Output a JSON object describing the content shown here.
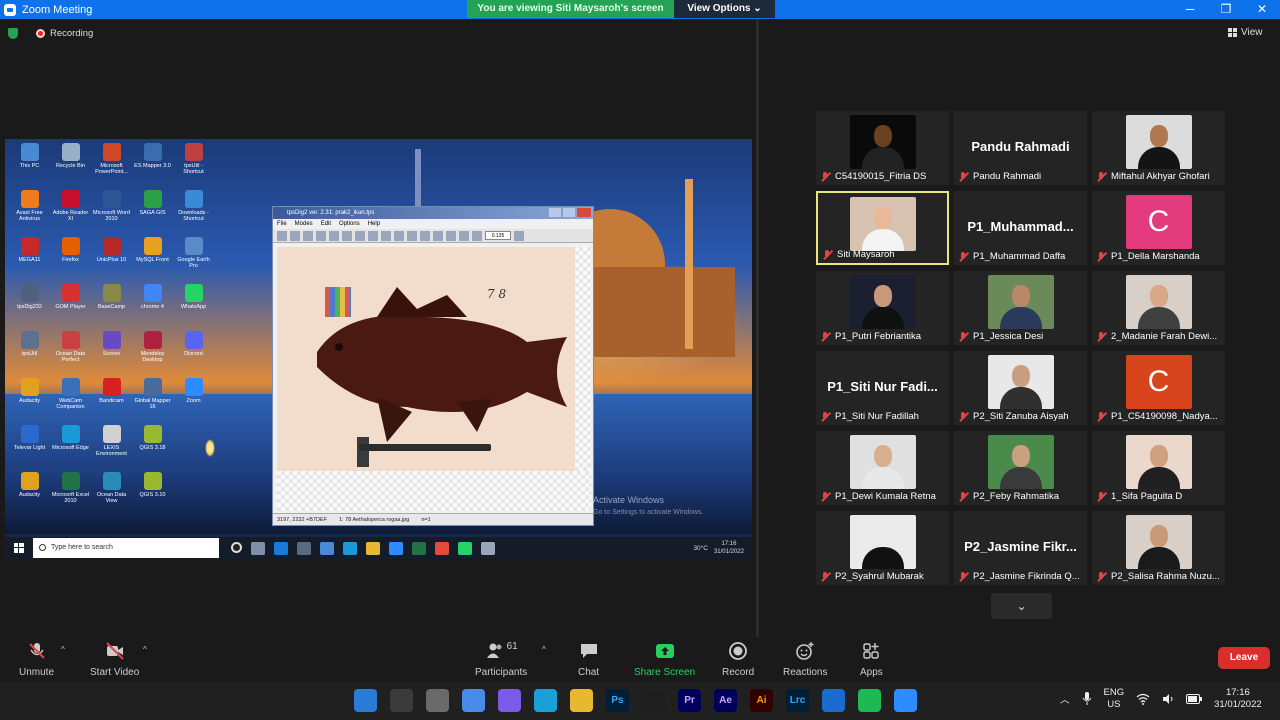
{
  "window": {
    "title": "Zoom Meeting",
    "banner": "You are viewing Siti Maysaroh's screen",
    "view_options": "View Options ⌄",
    "controls": [
      "─",
      "❐",
      "✕"
    ]
  },
  "status": {
    "recording": "Recording",
    "view": "View"
  },
  "shared_screen": {
    "desktop_icons": [
      {
        "label": "This PC",
        "color": "#4a8ad0"
      },
      {
        "label": "Recycle Bin",
        "color": "#9ab0c8"
      },
      {
        "label": "Microsoft PowerPoint...",
        "color": "#d24726"
      },
      {
        "label": "ES Mapper 3.0",
        "color": "#3c6cb0"
      },
      {
        "label": "Avast Free Antivirus",
        "color": "#f07a1e"
      },
      {
        "label": "Adobe Reader XI",
        "color": "#c8102e"
      },
      {
        "label": "Microsoft Word 2010",
        "color": "#2b5797"
      },
      {
        "label": "SAGA GIS",
        "color": "#2aa048"
      },
      {
        "label": "MEGA11",
        "color": "#c82828"
      },
      {
        "label": "Firefox",
        "color": "#e66000"
      },
      {
        "label": "UnicPlus 10",
        "color": "#b82828"
      },
      {
        "label": "MySQL Front",
        "color": "#e8a020"
      },
      {
        "label": "tpsDig232",
        "color": "#506080"
      },
      {
        "label": "GOM Player",
        "color": "#d83030"
      },
      {
        "label": "BaseCamp",
        "color": "#888848"
      },
      {
        "label": "chrome 4",
        "color": "#4285f4"
      },
      {
        "label": "tpsUtil",
        "color": "#607090"
      },
      {
        "label": "Ocean Data Perfect",
        "color": "#c84040"
      },
      {
        "label": "Screen",
        "color": "#6a4ac0"
      },
      {
        "label": "Mendeley Desktop",
        "color": "#b02040"
      },
      {
        "label": "Audacity",
        "color": "#e0a020"
      },
      {
        "label": "WebCam Companion",
        "color": "#3a70b8"
      },
      {
        "label": "Bandicam",
        "color": "#d82020"
      },
      {
        "label": "Global Mapper 16",
        "color": "#4a6a9a"
      },
      {
        "label": "Televar Light",
        "color": "#2a6ad0"
      },
      {
        "label": "Microsoft Edge",
        "color": "#1a9ad8"
      },
      {
        "label": "LEXIS Environment",
        "color": "#d0d0d0"
      },
      {
        "label": "QGIS 3.18",
        "color": "#98b830"
      },
      {
        "label": "Audacity",
        "color": "#e0a020"
      },
      {
        "label": "Microsoft Excel 2010",
        "color": "#217346"
      },
      {
        "label": "Ocean Data View",
        "color": "#2a8ab8"
      },
      {
        "label": "QGIS 3.10",
        "color": "#98b830"
      }
    ],
    "desktop_col5": [
      {
        "label": "tpsUtil - Shortcut",
        "color": "#c04040"
      },
      {
        "label": "Downloads - Shortcut",
        "color": "#3a8ad8"
      },
      {
        "label": "Google Earth Pro",
        "color": "#5a8ac8"
      },
      {
        "label": "WhatsApp",
        "color": "#25d366"
      },
      {
        "label": "Discord",
        "color": "#5865f2"
      },
      {
        "label": "Zoom",
        "color": "#2d8cff"
      }
    ],
    "tps": {
      "title": "tpsDig2 ver. 2.31: prak2_ikan.tps",
      "menu": [
        "File",
        "Modes",
        "Edit",
        "Options",
        "Help"
      ],
      "zoom": "0.135",
      "specimen_no": "7 8",
      "status_coords": "3197, 2232 +B7DEF",
      "status_file": "1: 78 Aethaloperca rogaa.jpg",
      "status_n": "n=1"
    },
    "activate_title": "Activate Windows",
    "activate_sub": "Go to Settings to activate Windows.",
    "taskbar": {
      "search": "Type here to search",
      "weather": "30°C",
      "time": "17:16",
      "date": "31/01/2022"
    }
  },
  "participants": [
    {
      "name": "C54190015_Fitria DS",
      "kind": "video",
      "bg": "#0a0a0a",
      "skin": "#6a4020",
      "shirt": "#222"
    },
    {
      "name": "Pandu Rahmadi",
      "kind": "text",
      "big": "Pandu Rahmadi"
    },
    {
      "name": "Miftahul Akhyar Ghofari",
      "kind": "video",
      "bg": "#dcdcdc",
      "skin": "#b07850",
      "shirt": "#141414"
    },
    {
      "name": "Siti Maysaroh",
      "kind": "video",
      "bg": "#d8c2b0",
      "skin": "#e8b898",
      "shirt": "#f4f4f4",
      "active": true
    },
    {
      "name": "P1_Muhammad Daffa",
      "kind": "text",
      "big": "P1_Muhammad..."
    },
    {
      "name": "P1_Della Marshanda",
      "kind": "initial",
      "initial": "C",
      "color": "#e23a7c"
    },
    {
      "name": "P1_Putri Febriantika",
      "kind": "video",
      "bg": "#1a2030",
      "skin": "#c89878",
      "shirt": "#101010"
    },
    {
      "name": "P1_Jessica Desi",
      "kind": "video",
      "bg": "#6a8a5a",
      "skin": "#b88868",
      "shirt": "#2a3a5a"
    },
    {
      "name": "2_Madanie Farah Dewi...",
      "kind": "video",
      "bg": "#d8d0c8",
      "skin": "#d8a888",
      "shirt": "#404040"
    },
    {
      "name": "P1_Siti Nur Fadillah",
      "kind": "text",
      "big": "P1_Siti Nur Fadi..."
    },
    {
      "name": "P2_Siti Zanuba Aisyah",
      "kind": "video",
      "bg": "#e8e8e8",
      "skin": "#c8a080",
      "shirt": "#303030"
    },
    {
      "name": "P1_C54190098_Nadya...",
      "kind": "initial",
      "initial": "C",
      "color": "#d8441c"
    },
    {
      "name": "P1_Dewi Kumala Retna",
      "kind": "video",
      "bg": "#e0e0e0",
      "skin": "#d8b090",
      "shirt": "#e8e8e8"
    },
    {
      "name": "P2_Feby Rahmatika",
      "kind": "video",
      "bg": "#4a8a4a",
      "skin": "#caa080",
      "shirt": "#3a3a3a"
    },
    {
      "name": "1_Sifa Paguita D",
      "kind": "video",
      "bg": "#ead8cc",
      "skin": "#d0a080",
      "shirt": "#202020"
    },
    {
      "name": "P2_Syahrul Mubarak",
      "kind": "video",
      "bg": "#eaeaea",
      "skin": "#eaeaea",
      "shirt": "#111"
    },
    {
      "name": "P2_Jasmine Fikrinda Q...",
      "kind": "text",
      "big": "P2_Jasmine Fikr..."
    },
    {
      "name": "P2_Salisa Rahma Nuzu...",
      "kind": "video",
      "bg": "#d8d0c8",
      "skin": "#c89a78",
      "shirt": "#1a1a1a"
    }
  ],
  "controls": {
    "unmute": "Unmute",
    "start_video": "Start Video",
    "participants_count": "61",
    "participants": "Participants",
    "chat": "Chat",
    "share_screen": "Share Screen",
    "record": "Record",
    "reactions": "Reactions",
    "apps": "Apps",
    "leave": "Leave"
  },
  "taskbar": {
    "apps": [
      {
        "label": "",
        "color": "#2a7ad8"
      },
      {
        "label": "",
        "color": "#3a3a3a"
      },
      {
        "label": "",
        "color": "#6a6a6a"
      },
      {
        "label": "",
        "color": "#4a8ae8"
      },
      {
        "label": "",
        "color": "#7a5ae8"
      },
      {
        "label": "",
        "color": "#1aa0d8"
      },
      {
        "label": "",
        "color": "#e8b830"
      },
      {
        "label": "Ps",
        "color": "#001e36"
      },
      {
        "label": "",
        "color": "#1e1e1e"
      },
      {
        "label": "Pr",
        "color": "#00005b"
      },
      {
        "label": "Ae",
        "color": "#00005b"
      },
      {
        "label": "Ai",
        "color": "#330000"
      },
      {
        "label": "Lrc",
        "color": "#001e36"
      },
      {
        "label": "",
        "color": "#1a6ad0"
      },
      {
        "label": "",
        "color": "#1db954"
      },
      {
        "label": "",
        "color": "#2d8cff"
      }
    ],
    "lang_top": "ENG",
    "lang_bottom": "US",
    "time": "17:16",
    "date": "31/01/2022"
  }
}
